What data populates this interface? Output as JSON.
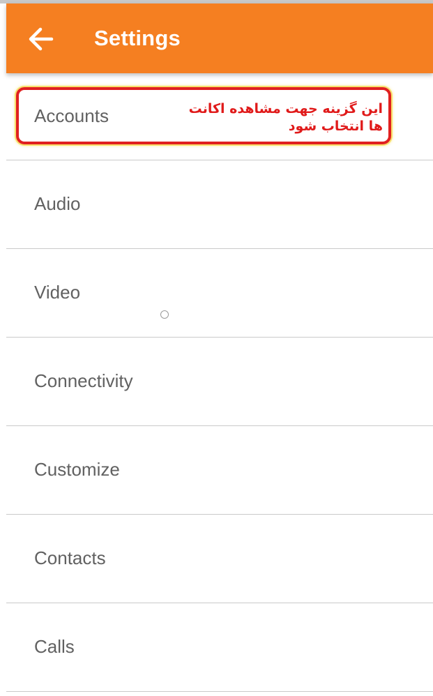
{
  "app_bar": {
    "title": "Settings",
    "background_color": "#f57f21",
    "back_icon": "arrow-left-icon"
  },
  "settings_list": {
    "items": [
      {
        "label": "Accounts"
      },
      {
        "label": "Audio"
      },
      {
        "label": "Video"
      },
      {
        "label": "Connectivity"
      },
      {
        "label": "Customize"
      },
      {
        "label": "Contacts"
      },
      {
        "label": "Calls"
      }
    ]
  },
  "annotation": {
    "line1": "این گزینه جهت مشاهده اکانت",
    "line2": "ها انتخاب شود",
    "color": "#e01a1a"
  },
  "colors": {
    "label_text": "#616161",
    "divider": "#c9c9c9"
  }
}
